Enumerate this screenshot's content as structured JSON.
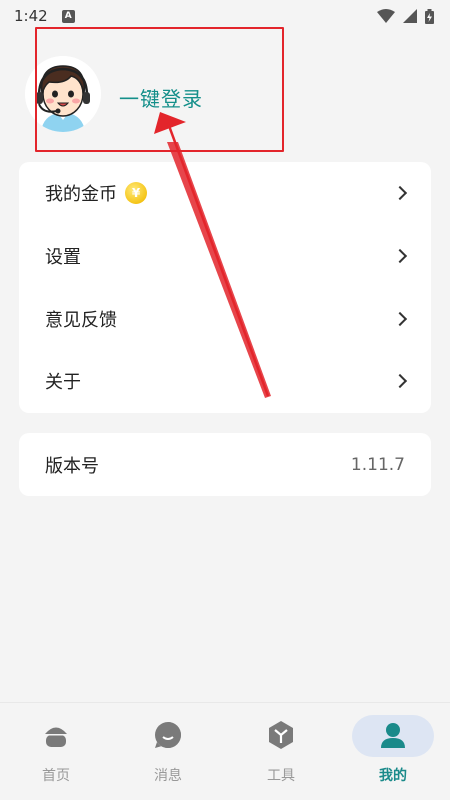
{
  "status_bar": {
    "time": "1:42",
    "notif_letter": "A"
  },
  "profile": {
    "login_label": "一键登录",
    "avatar_icon": "customer-service-avatar"
  },
  "menu": {
    "items": [
      {
        "label": "我的金币",
        "coin_symbol": "¥"
      },
      {
        "label": "设置"
      },
      {
        "label": "意见反馈"
      },
      {
        "label": "关于"
      }
    ]
  },
  "version": {
    "label": "版本号",
    "value": "1.11.7"
  },
  "tabs": [
    {
      "label": "首页",
      "icon": "home-icon"
    },
    {
      "label": "消息",
      "icon": "message-icon"
    },
    {
      "label": "工具",
      "icon": "tools-icon"
    },
    {
      "label": "我的",
      "icon": "profile-icon",
      "active": true
    }
  ],
  "colors": {
    "accent": "#148f8a",
    "highlight_box": "#e3252b",
    "active_pill": "#dde5f3"
  }
}
